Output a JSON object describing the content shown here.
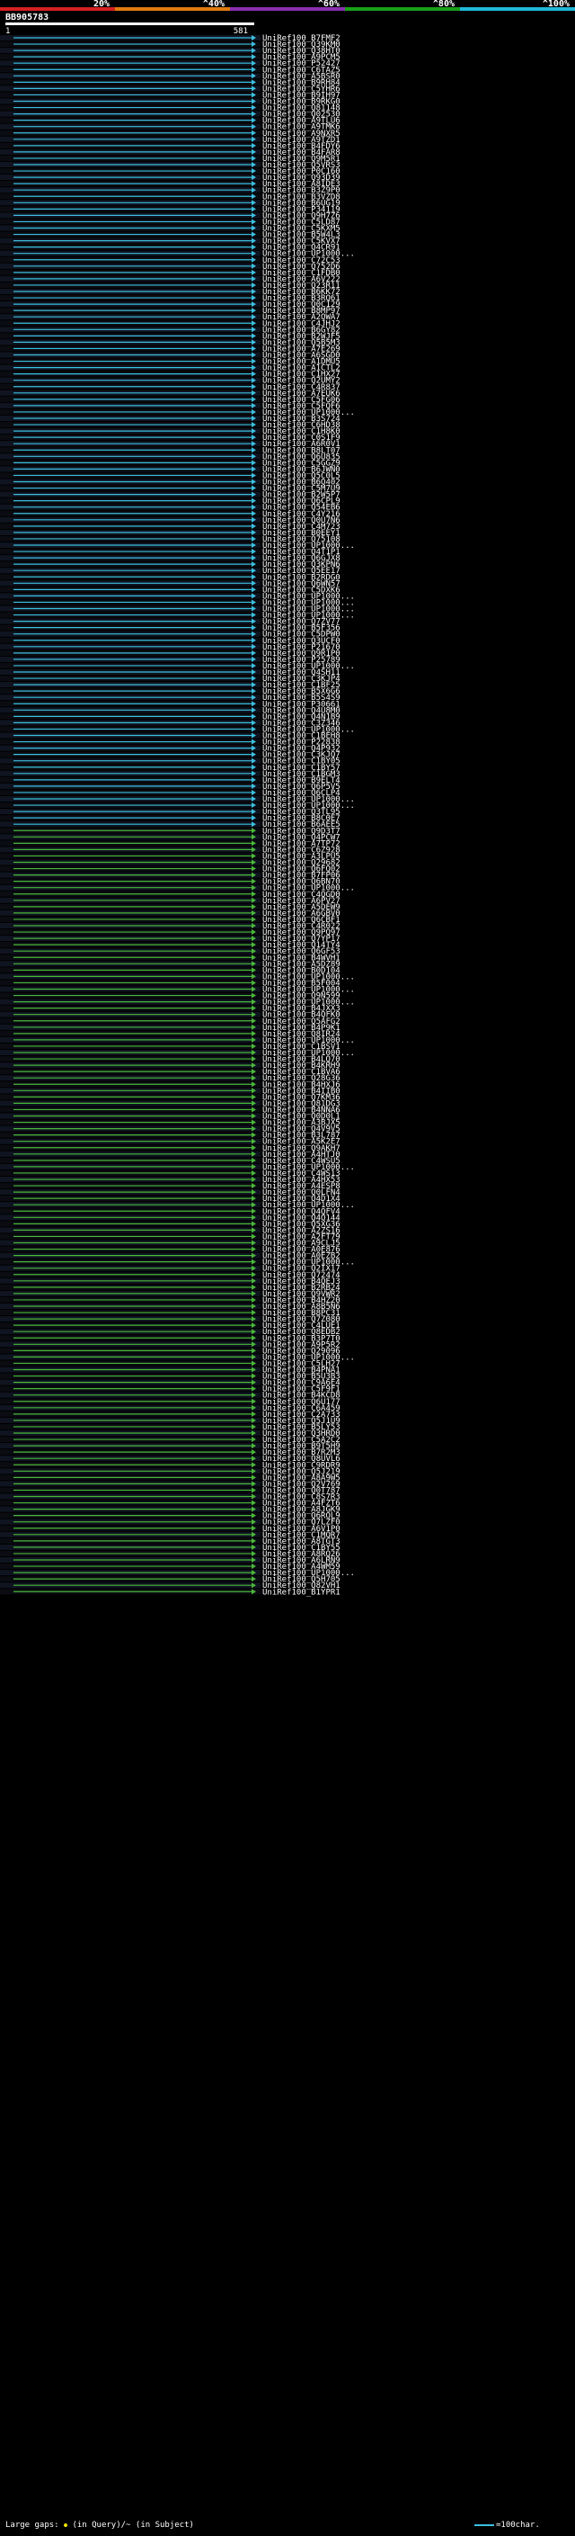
{
  "chart_data": {
    "type": "alignment-overview",
    "query_name": "BB905783",
    "query_start": "1",
    "query_end": "581",
    "identity_scale": [
      {
        "label": "20%",
        "color": "#d62020"
      },
      {
        "label": "^40%",
        "color": "#e07a10"
      },
      {
        "label": "^60%",
        "color": "#8a2fb0"
      },
      {
        "label": "^80%",
        "color": "#18a018"
      },
      {
        "label": "^100%",
        "color": "#20b8d8"
      }
    ],
    "colors": {
      "high": "#3cc0e0",
      "mid": "#4ab83a",
      "background": "#000000",
      "frame": "#1a1f2a"
    },
    "hits": [
      "UniRef100_B7FMF2",
      "UniRef100_Q39KM0",
      "UniRef100_Q38HT0",
      "UniRef100_A9PCM5",
      "UniRef100_P52427",
      "UniRef100_C6TAZ5",
      "UniRef100_A5BSR0",
      "UniRef100_B9RH84",
      "UniRef100_C5YHR6",
      "UniRef100_B9IH97",
      "UniRef100_B9RKG0",
      "UniRef100_Q81148",
      "UniRef100_Q02530",
      "UniRef100_A9TLU6",
      "UniRef100_A9TMK6",
      "UniRef100_A9NXR5",
      "UniRef100_A9TZD1",
      "UniRef100_B4FDY6",
      "UniRef100_B4FAR8",
      "UniRef100_Q9M5R1",
      "UniRef100_Q5VRS3",
      "UniRef100_P0C160",
      "UniRef100_Q93D39",
      "UniRef100_A8IDE3",
      "UniRef100_B3Z9P0",
      "UniRef100_B3VZD8",
      "UniRef100_B6UG19",
      "UniRef100_P34119",
      "UniRef100_Q9H7Z6",
      "UniRef100_C5LD87",
      "UniRef100_C5KXM5",
      "UniRef100_B5W4L3",
      "UniRef100_C5KVX7",
      "UniRef100_Q4CR91",
      "UniRef100_UP1000...",
      "UniRef100_C72C53",
      "UniRef100_Q752D6",
      "UniRef100_C1FDB0",
      "UniRef100_A6V222",
      "UniRef100_Q23R11",
      "UniRef100_B6KK72",
      "UniRef100_B3RQ61",
      "UniRef100_Q0C129",
      "UniRef100_B8MP97",
      "UniRef100_A2QWA7",
      "UniRef100_C4JHJ2",
      "UniRef100_B6GY82",
      "UniRef100_B2WJF5",
      "UniRef100_Q5B5M3",
      "UniRef100_A7E269",
      "UniRef100_A6SGD0",
      "UniRef100_A1DMU5",
      "UniRef100_A1CTL2",
      "UniRef100_C1HX27",
      "UniRef100_Q2UMY2",
      "UniRef100_C4R837",
      "UniRef100_A7EUK6",
      "UniRef100_C5FG06",
      "UniRef100_C5FQF6",
      "UniRef100_UP1000...",
      "UniRef100_B3S724",
      "UniRef100_C6HD38",
      "UniRef100_C1H8K0",
      "UniRef100_C0S1F9",
      "UniRef100_A6R0V1",
      "UniRef100_B8LT07",
      "UniRef100_Q6U835",
      "UniRef100_C5GGZ9",
      "UniRef100_B6JWN0",
      "UniRef100_Q5C0L5",
      "UniRef100_B6Q402",
      "UniRef100_C5M7U9",
      "UniRef100_B2W5P7",
      "UniRef100_Q6CPL9",
      "UniRef100_Q54EB6",
      "UniRef100_C4Y216",
      "UniRef100_Q0U7N6",
      "UniRef100_C4M723",
      "UniRef100_B0EEY1",
      "UniRef100_Q75108",
      "UniRef100_UP1000...",
      "UniRef100_Q4T1P1",
      "UniRef100_Q6GJX8",
      "UniRef100_Q3KPN6",
      "UniRef100_Q5EE17",
      "UniRef100_B2RDG0",
      "UniRef100_Q6WN57",
      "UniRef100_C5DXK6",
      "UniRef100_UP1000...",
      "UniRef100_UP1000...",
      "UniRef100_UP1000...",
      "UniRef100_UP1000...",
      "UniRef100_Q7ZV77",
      "UniRef100_B5F356",
      "UniRef100_C5DPW0",
      "UniRef100_Q3UCF0",
      "UniRef100_P21670",
      "UniRef100_Q9R1P0",
      "UniRef100_P25789",
      "UniRef100_UP1000...",
      "UniRef100_Q4SH11",
      "UniRef100_C3KJP4",
      "UniRef100_C1BF25",
      "UniRef100_B5X6G6",
      "UniRef100_B5S4S9",
      "UniRef100_P30661",
      "UniRef100_Q4U8M0",
      "UniRef100_Q4N1B9",
      "UniRef100_C3Z346",
      "UniRef100_UP1000...",
      "UniRef100_C1BEH8",
      "UniRef100_P22838",
      "UniRef100_Q4P932",
      "UniRef100_C3KJQ7",
      "UniRef100_C1BY05",
      "UniRef100_C1BY57",
      "UniRef100_C1BGM3",
      "UniRef100_B9ELT4",
      "UniRef100_Q6P5V5",
      "UniRef100_Q6CLP4",
      "UniRef100_UP1000...",
      "UniRef100_UP1000...",
      "UniRef100_Q3TL95",
      "UniRef100_B8C0E7",
      "UniRef100_B6AEE5",
      "UniRef100_Q9D3T7",
      "UniRef100_Q4PCW7",
      "UniRef100_A7TP72",
      "UniRef100_C6Z928",
      "UniRef100_A3LPU5",
      "UniRef100_Q29682",
      "UniRef100_Q6FQ02",
      "UniRef100_B7FP06",
      "UniRef100_Q6BN70",
      "UniRef100_UP1000...",
      "UniRef100_C4QGD0",
      "UniRef100_A6PV27",
      "UniRef100_A5DEW9",
      "UniRef100_A6GBV0",
      "UniRef100_Q6CBF1",
      "UniRef100_C4R022",
      "UniRef100_Q9PQ97",
      "UniRef100_Q7YP17",
      "UniRef100_Q14TY4",
      "UniRef100_Q6GF53",
      "UniRef100_B4WVH1",
      "UniRef100_A5DZ89",
      "UniRef100_B0D104",
      "UniRef100_UP1000...",
      "UniRef100_B5F004",
      "UniRef100_UP1000...",
      "UniRef100_Q9N599",
      "UniRef100_UP1000...",
      "UniRef100_B4JXX3",
      "UniRef100_B4QFK0",
      "UniRef100_Q5AFG2",
      "UniRef100_B4P9K1",
      "UniRef100_Q8IR24",
      "UniRef100_UP1000...",
      "UniRef100_C1BSV1",
      "UniRef100_UP1000...",
      "UniRef100_B4LQ70",
      "UniRef100_B4KRH9",
      "UniRef100_C1BVA6",
      "UniRef100_Q28G36",
      "UniRef100_B4HXJ6",
      "UniRef100_B4IIB0",
      "UniRef100_Q7KM36",
      "UniRef100_Q81DG3",
      "UniRef100_B4NNA6",
      "UniRef100_Q0D0L1",
      "UniRef100_A3BJX5",
      "UniRef100_Q4V9V5",
      "UniRef100_B3L787",
      "UniRef100_A5K2E7",
      "UniRef100_Q9AKH7",
      "UniRef100_A4HTJ0",
      "UniRef100_C4WSU5",
      "UniRef100_UP1000...",
      "UniRef100_C4WS13",
      "UniRef100_A4HX53",
      "UniRef100_A4ESP8",
      "UniRef100_Q0LFN4",
      "UniRef100_Q4D1X4",
      "UniRef100_UP1000...",
      "UniRef100_Q4QFV4",
      "UniRef100_Q4Q144",
      "UniRef100_Q5XG36",
      "UniRef100_A2ZS16",
      "UniRef100_A2FT79",
      "UniRef100_A9CLJ5",
      "UniRef100_A0E876",
      "UniRef100_A0EZB2",
      "UniRef100_UP1000...",
      "UniRef100_Q2IX17",
      "UniRef100_Q72474",
      "UniRef100_B4QEJ3",
      "UniRef100_B2RB24",
      "UniRef100_Q9VWR2",
      "UniRef100_B4HZ20",
      "UniRef100_A8B5N6",
      "UniRef100_B8PC31",
      "UniRef100_Q7Z080",
      "UniRef100_C4LUE1",
      "UniRef100_Q8EDB2",
      "UniRef100_B3P7T0",
      "UniRef100_A9P5R2",
      "UniRef100_Q29096",
      "UniRef100_UP1000...",
      "UniRef100_C5LH27",
      "UniRef100_B4PNA1",
      "UniRef100_B5U3B3",
      "UniRef100_C9A6E4",
      "UniRef100_C5F9F1",
      "UniRef100_B4KCD8",
      "UniRef100_Q6U177",
      "UniRef100_C6A459",
      "UniRef100_C2A733",
      "UniRef100_Q5J1U9",
      "UniRef100_B5LY53",
      "UniRef100_Q3HRD0",
      "UniRef100_C5A2C2",
      "UniRef100_B9T5H9",
      "UniRef100_B7R2M3",
      "UniRef100_Q8UVL6",
      "UniRef100_C9RDR9",
      "UniRef100_Q5J219",
      "UniRef100_A8A9W5",
      "UniRef100_Q2V769",
      "UniRef100_Q0T787",
      "UniRef100_C8S7R3",
      "UniRef100_A4FZT6",
      "UniRef100_A8JGK9",
      "UniRef100_Q6ROL9",
      "UniRef100_Q7LZF0",
      "UniRef100_A6V1P0",
      "UniRef100_C1MQR7",
      "UniRef100_A8TGT3",
      "UniRef100_C1BY55",
      "UniRef100_A8RQ26",
      "UniRef100_A6LRN9",
      "UniRef100_A4WM59",
      "UniRef100_UP1000...",
      "UniRef100_Q5H705",
      "UniRef100_Q82VH1",
      "UniRef100_B1YPR1"
    ],
    "legend": {
      "gaps_label": "Large gaps:",
      "in_query": "(in Query)",
      "in_subject": "/~ (in Subject)",
      "scale": "=100char."
    }
  }
}
